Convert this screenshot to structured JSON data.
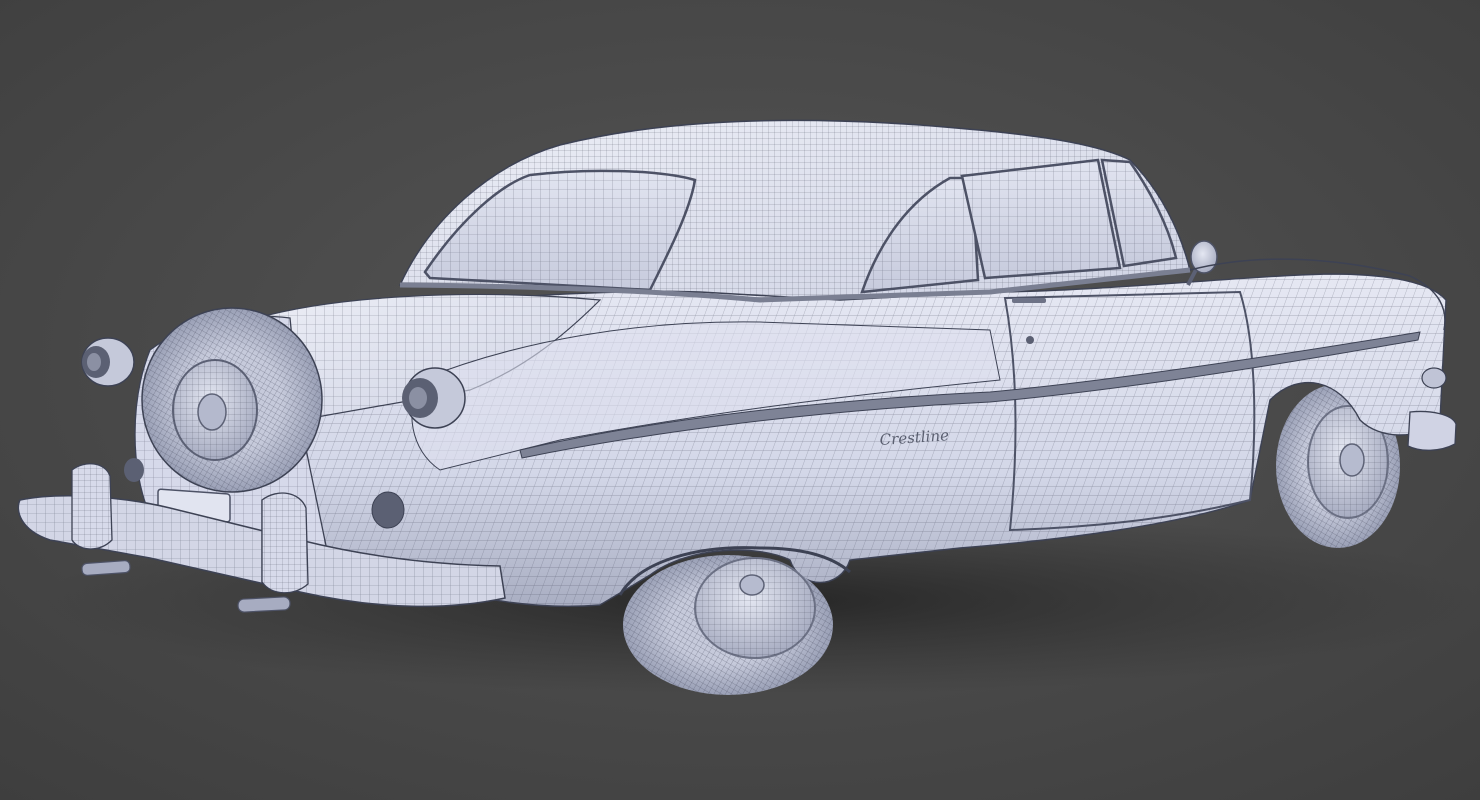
{
  "scene": {
    "subject": "vintage-hardtop-coupe-wireframe-render",
    "background_color": "#4b4b4b",
    "body_color": "#d9dcec",
    "wire_color": "#3d4254",
    "chrome_color": "#8a8d99",
    "tire_color": "#bfc3d3",
    "fender_script": "Crestline"
  }
}
